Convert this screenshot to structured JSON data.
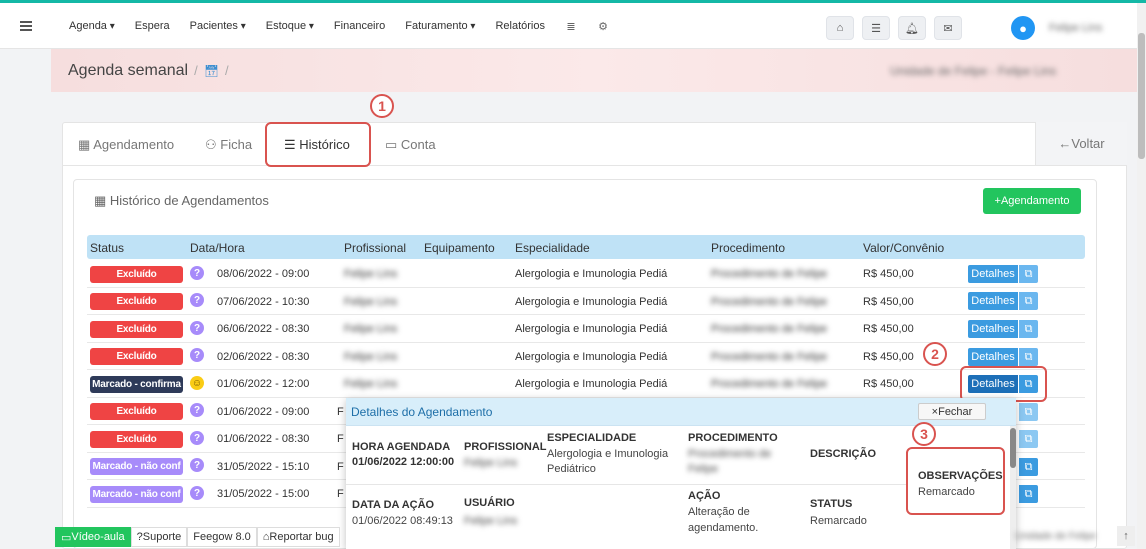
{
  "nav": {
    "menu": [
      "Agenda",
      "Espera",
      "Pacientes",
      "Estoque",
      "Financeiro",
      "Faturamento",
      "Relatórios"
    ],
    "user_name": "Felipe Lins"
  },
  "header": {
    "title": "Agenda semanal",
    "unit": "Unidade de Felipe - Felipe Lins"
  },
  "tabs": [
    "Agendamento",
    "Ficha",
    "Histórico",
    "Conta"
  ],
  "voltar": "Voltar",
  "annotations": [
    "1",
    "2",
    "3"
  ],
  "panel": {
    "title": "Histórico de Agendamentos",
    "add_button": "Agendamento"
  },
  "table": {
    "headers": [
      "Status",
      "Data/Hora",
      "Profissional",
      "Equipamento",
      "Especialidade",
      "Procedimento",
      "Valor/Convênio"
    ],
    "rows": [
      {
        "status": "Excluído",
        "datetime": "08/06/2022 - 09:00",
        "profissional": "Felipe Lins",
        "especialidade": "Alergologia e Imunologia Pediá",
        "procedimento": "Procedimento de Felipe",
        "valor": "R$ 450,00"
      },
      {
        "status": "Excluído",
        "datetime": "07/06/2022 - 10:30",
        "profissional": "Felipe Lins",
        "especialidade": "Alergologia e Imunologia Pediá",
        "procedimento": "Procedimento de Felipe",
        "valor": "R$ 450,00"
      },
      {
        "status": "Excluído",
        "datetime": "06/06/2022 - 08:30",
        "profissional": "Felipe Lins",
        "especialidade": "Alergologia e Imunologia Pediá",
        "procedimento": "Procedimento de Felipe",
        "valor": "R$ 450,00"
      },
      {
        "status": "Excluído",
        "datetime": "02/06/2022 - 08:30",
        "profissional": "Felipe Lins",
        "especialidade": "Alergologia e Imunologia Pediá",
        "procedimento": "Procedimento de Felipe",
        "valor": "R$ 450,00"
      },
      {
        "status": "Marcado - confirma",
        "datetime": "01/06/2022 - 12:00",
        "profissional": "Felipe Lins",
        "especialidade": "Alergologia e Imunologia Pediá",
        "procedimento": "Procedimento de Felipe",
        "valor": "R$ 450,00"
      },
      {
        "status": "Excluído",
        "datetime": "01/06/2022 - 09:00",
        "profissional": "F"
      },
      {
        "status": "Excluído",
        "datetime": "01/06/2022 - 08:30",
        "profissional": "F"
      },
      {
        "status": "Marcado - não conf",
        "datetime": "31/05/2022 - 15:10",
        "profissional": "F"
      },
      {
        "status": "Marcado - não conf",
        "datetime": "31/05/2022 - 15:00",
        "profissional": "F"
      }
    ],
    "details_label": "Detalhes"
  },
  "popup": {
    "title": "Detalhes do Agendamento",
    "close": "Fechar",
    "hora_label": "HORA AGENDADA",
    "hora_value": "01/06/2022 12:00:00",
    "prof_label": "PROFISSIONAL",
    "prof_value": "Felipe Lins",
    "esp_label": "ESPECIALIDADE",
    "esp_value_1": "Alergologia e Imunologia",
    "esp_value_2": "Pediátrico",
    "proc_label": "PROCEDIMENTO",
    "proc_value_1": "Procedimento de",
    "proc_value_2": "Felipe",
    "desc_label": "DESCRIÇÃO",
    "obs_label": "OBSERVAÇÕES",
    "obs_value": "Remarcado",
    "data_acao_label": "DATA DA AÇÃO",
    "data_acao_value": "01/06/2022 08:49:13",
    "usuario_label": "USUÁRIO",
    "usuario_value": "Felipe Lins",
    "acao_label": "AÇÃO",
    "acao_value_1": "Alteração de",
    "acao_value_2": "agendamento.",
    "status_label": "STATUS",
    "status_value": "Remarcado"
  },
  "footer": {
    "video": "Vídeo-aula",
    "suporte": "Suporte",
    "version": "Feegow 8.0",
    "bug": "Reportar bug",
    "right_text": "Unidade de Felipe"
  },
  "colors": {
    "accent": "#14b8a6",
    "excluido": "#ef4444",
    "confirmado": "#2e3a59",
    "nao_conf": "#a78bfa",
    "annotation": "#d9534f"
  }
}
